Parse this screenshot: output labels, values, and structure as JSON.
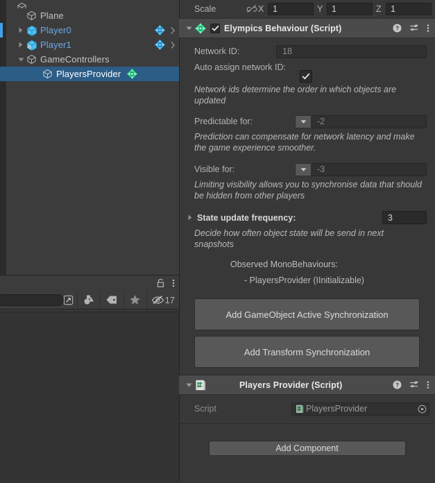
{
  "hierarchy": {
    "rows": [
      {
        "label": "",
        "clipped": true,
        "indent": 0,
        "icon": "cube-icon",
        "twisty": "none",
        "prefab": false,
        "selected": false,
        "gem": false,
        "chevron": false
      },
      {
        "label": "Plane",
        "indent": 1,
        "icon": "cube-icon",
        "twisty": "none",
        "prefab": false,
        "selected": false,
        "gem": false,
        "chevron": false
      },
      {
        "label": "Player0",
        "indent": 1,
        "icon": "prefab-cube-icon",
        "twisty": "collapsed",
        "prefab": true,
        "selected": false,
        "gem": true,
        "chevron": true
      },
      {
        "label": "Player1",
        "indent": 1,
        "icon": "prefab-variant-cube-icon",
        "twisty": "collapsed",
        "prefab": true,
        "selected": false,
        "gem": true,
        "chevron": true
      },
      {
        "label": "GameControllers",
        "indent": 1,
        "icon": "cube-icon",
        "twisty": "expanded",
        "prefab": false,
        "selected": false,
        "gem": false,
        "chevron": false
      },
      {
        "label": "PlayersProvider",
        "indent": 2,
        "icon": "cube-icon",
        "twisty": "none",
        "prefab": false,
        "selected": true,
        "gem": true,
        "chevron": false
      }
    ]
  },
  "project": {
    "tab_icons": [
      "lock-icon",
      "kebab-menu-icon"
    ],
    "search": {
      "value": "",
      "placeholder": ""
    },
    "search_pick_icon": "search-in-scene-icon",
    "filters": [
      {
        "icon": "object-type-filter-icon",
        "label": ""
      },
      {
        "icon": "label-tag-filter-icon",
        "label": ""
      },
      {
        "icon": "favorite-star-filter-icon",
        "label": ""
      },
      {
        "icon": "hidden-objects-icon",
        "label": "17"
      }
    ]
  },
  "inspector": {
    "scale": {
      "label": "Scale",
      "link_icon": "link-broken-icon",
      "axes": [
        {
          "name": "X",
          "value": "1"
        },
        {
          "name": "Y",
          "value": "1"
        },
        {
          "name": "Z",
          "value": "1"
        }
      ]
    },
    "elympics": {
      "title": "Elympics Behaviour (Script)",
      "icon": "elympics-gem-icon",
      "enabled": true,
      "foldout": "expanded",
      "actions": [
        "help-icon",
        "preset-icon",
        "kebab-menu-icon"
      ],
      "network_id": {
        "label": "Network ID:",
        "value": "18"
      },
      "auto_assign": {
        "label": "Auto assign network ID:",
        "checked": true,
        "help": "Network ids determine the order in which objects are updated"
      },
      "predictable": {
        "label": "Predictable for:",
        "value": "-2",
        "help": "Prediction can compensate for network latency and make the game experience smoother."
      },
      "visible": {
        "label": "Visible for:",
        "value": "-3",
        "help": "Limiting visibility allows you to synchronise data that should be hidden from other players"
      },
      "state_update": {
        "label": "State update frequency:",
        "value": "3",
        "foldout": "collapsed",
        "help": "Decide how often object state will be send in next snapshots"
      },
      "observed_title": "Observed MonoBehaviours:",
      "observed_items": [
        "- PlayersProvider (IInitializable)"
      ],
      "buttons": [
        "Add GameObject Active Synchronization",
        "Add Transform Synchronization"
      ]
    },
    "players_provider": {
      "title": "Players Provider (Script)",
      "icon": "cs-script-icon",
      "foldout": "expanded",
      "actions": [
        "help-icon",
        "preset-icon",
        "kebab-menu-icon"
      ],
      "script_label": "Script",
      "script_value": "PlayersProvider",
      "script_icon": "cs-script-icon",
      "picker_icon": "object-picker-icon"
    },
    "add_component": "Add Component"
  },
  "colors": {
    "selection_blue": "#2c5d87",
    "prefab_blue": "#6ea8e8",
    "elympics_green": "#3ddc84",
    "panel_bg": "#383838",
    "header_bg": "#4b4b4b"
  }
}
